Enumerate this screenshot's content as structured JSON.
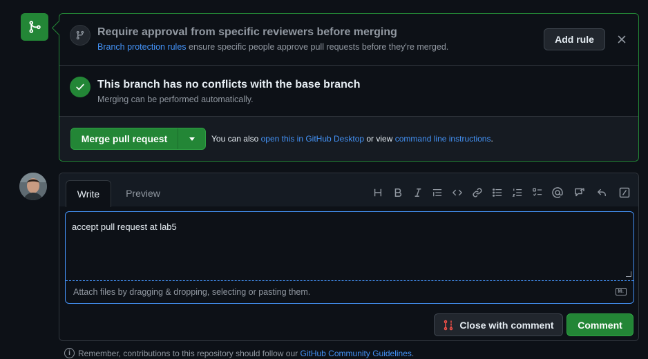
{
  "merge_box": {
    "protection": {
      "title": "Require approval from specific reviewers before merging",
      "link_text": "Branch protection rules",
      "subtitle_rest": " ensure specific people approve pull requests before they're merged.",
      "add_rule_label": "Add rule",
      "close_label": "×"
    },
    "conflicts": {
      "title": "This branch has no conflicts with the base branch",
      "subtitle": "Merging can be performed automatically."
    },
    "actions": {
      "merge_label": "Merge pull request",
      "also_prefix": "You can also ",
      "desktop_link": "open this in GitHub Desktop",
      "also_middle": " or view ",
      "cli_link": "command line instructions",
      "also_suffix": "."
    }
  },
  "comment": {
    "tabs": {
      "write": "Write",
      "preview": "Preview"
    },
    "toolbar_icons": [
      "heading-icon",
      "bold-icon",
      "italic-icon",
      "quote-icon",
      "code-icon",
      "link-icon",
      "unordered-list-icon",
      "ordered-list-icon",
      "task-list-icon",
      "mention-icon",
      "reference-icon",
      "reply-icon",
      "slash-commands-icon"
    ],
    "editor_text": "accept pull request at lab5",
    "attach_text": "Attach files by dragging & dropping, selecting or pasting them.",
    "markdown_badge": "M↓",
    "close_with_comment_label": "Close with comment",
    "comment_label": "Comment"
  },
  "footer": {
    "remember_prefix": "Remember, contributions to this repository should follow our ",
    "guidelines_link": "GitHub Community Guidelines",
    "remember_suffix": "."
  },
  "colors": {
    "background": "#0d1117",
    "green": "#238636",
    "link": "#4493f8",
    "muted": "#9198a1",
    "danger": "#f85149"
  }
}
